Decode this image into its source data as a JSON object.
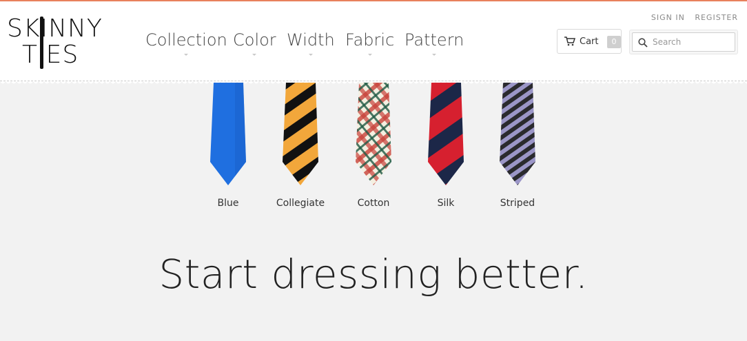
{
  "brand": {
    "logo_line1": "SKINNY",
    "logo_line2": "TIES",
    "accent_color": "#e8805c"
  },
  "nav": {
    "items": [
      {
        "label": "Collection"
      },
      {
        "label": "Color"
      },
      {
        "label": "Width"
      },
      {
        "label": "Fabric"
      },
      {
        "label": "Pattern"
      }
    ]
  },
  "account": {
    "sign_in": "SIGN IN",
    "register": "REGISTER"
  },
  "cart": {
    "label": "Cart",
    "count": "0",
    "icon": "cart-icon"
  },
  "search": {
    "placeholder": "Search",
    "value": "",
    "icon": "search-icon"
  },
  "ties": [
    {
      "label": "Blue",
      "pattern": "solid",
      "colors": [
        "#1f6fe0",
        "#1a5fc8"
      ]
    },
    {
      "label": "Collegiate",
      "pattern": "stripe",
      "colors": [
        "#f2a73b",
        "#111111"
      ]
    },
    {
      "label": "Cotton",
      "pattern": "plaid",
      "colors": [
        "#f4efe0",
        "#c8423a",
        "#1f5a45"
      ]
    },
    {
      "label": "Silk",
      "pattern": "stripe",
      "colors": [
        "#d6202f",
        "#1c2748"
      ]
    },
    {
      "label": "Striped",
      "pattern": "stripe",
      "colors": [
        "#9b96c7",
        "#2a2a2e"
      ]
    }
  ],
  "hero": {
    "headline": "Start dressing better."
  }
}
